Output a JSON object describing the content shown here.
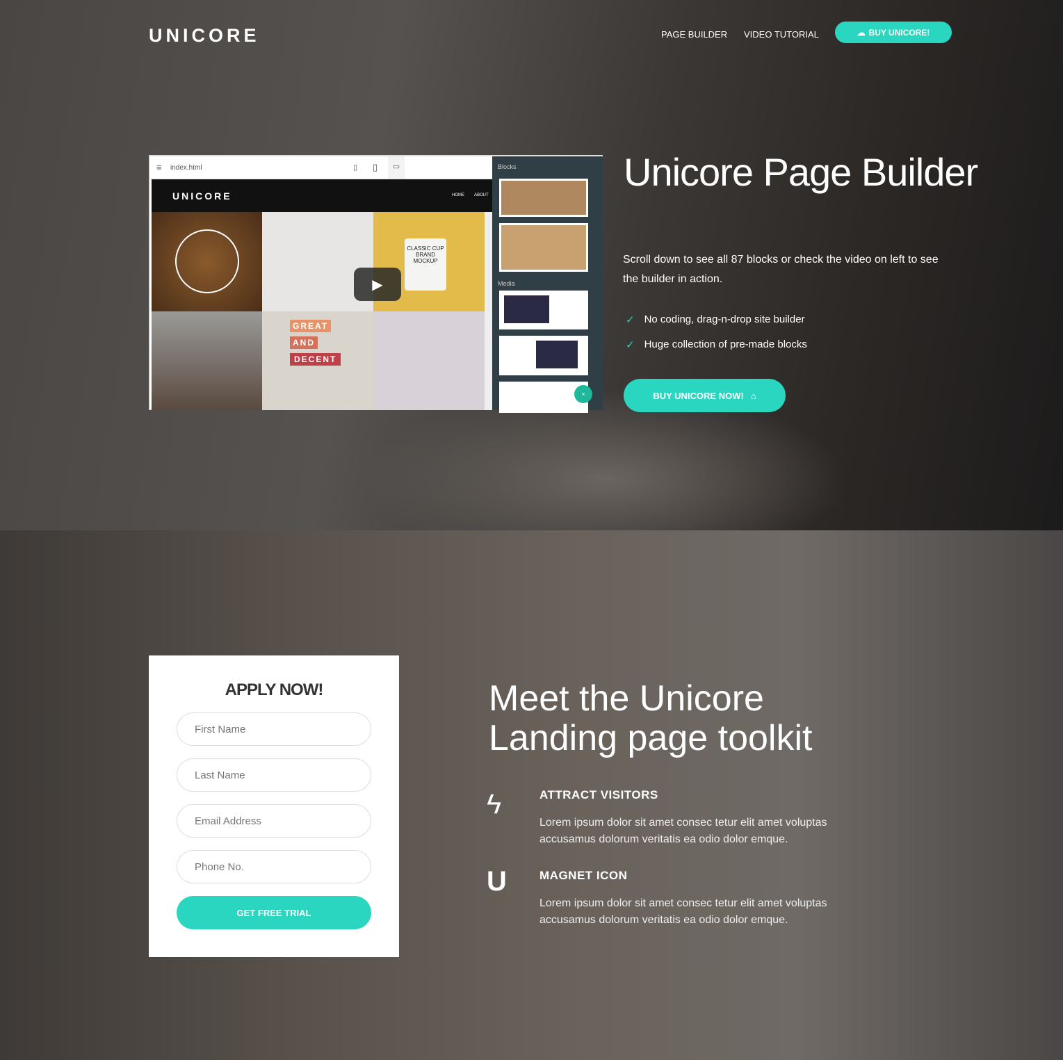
{
  "header": {
    "logo": "UNICORE",
    "nav": [
      "PAGE BUILDER",
      "VIDEO TUTORIAL"
    ],
    "buy_label": "BUY UNICORE!",
    "accent": "#2bd6c0"
  },
  "mockup": {
    "filename": "index.html",
    "site_logo": "UNICORE",
    "site_nav": [
      "HOME",
      "ABOUT"
    ],
    "sidebar_title": "Blocks",
    "sidebar_section": "Media",
    "poster": [
      "GREAT",
      "AND",
      "DECENT"
    ],
    "mug": "CLASSIC CUP BRAND MOCKUP"
  },
  "hero": {
    "title": "Unicore Page Builder",
    "description": "Scroll down to see all 87 blocks or check the video on left to see the builder in action.",
    "features": [
      "No coding, drag-n-drop site builder",
      "Huge collection of pre-made blocks"
    ],
    "cta": "BUY UNICORE NOW!"
  },
  "form": {
    "title": "APPLY NOW!",
    "fields": [
      "First Name",
      "Last Name",
      "Email Address",
      "Phone No."
    ],
    "submit": "GET FREE TRIAL"
  },
  "toolkit": {
    "title": "Meet the Unicore Landing page toolkit",
    "features": [
      {
        "icon": "lightning-icon",
        "title": "ATTRACT VISITORS",
        "text": "Lorem ipsum dolor sit amet consec tetur elit amet voluptas accusamus dolorum veritatis ea odio dolor emque."
      },
      {
        "icon": "magnet-icon",
        "title": "MAGNET ICON",
        "text": "Lorem ipsum dolor sit amet consec tetur elit amet voluptas accusamus dolorum veritatis ea odio dolor emque."
      }
    ]
  }
}
